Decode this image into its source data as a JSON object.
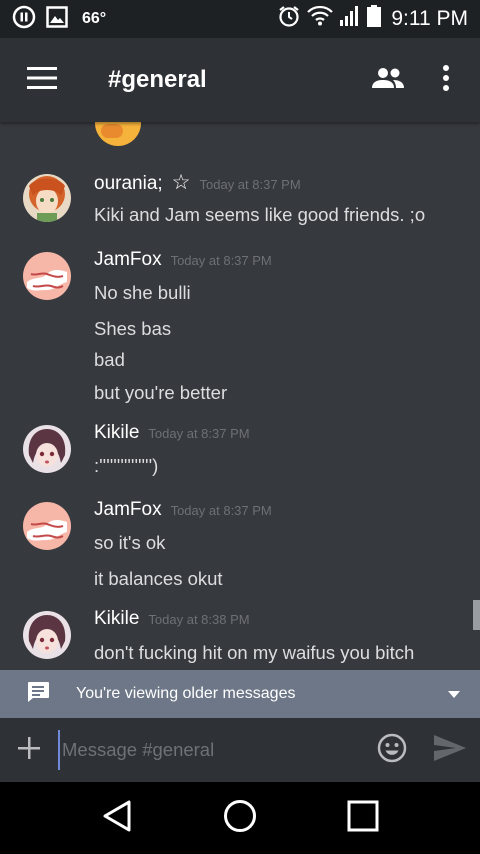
{
  "status_bar": {
    "temperature": "66°",
    "time": "9:11 PM"
  },
  "app_bar": {
    "channel": "#general"
  },
  "messages": [
    {
      "author": "ourania;",
      "star": "☆",
      "timestamp": "Today at 8:37 PM",
      "lines": [
        "Kiki and Jam seems like good friends. ;o"
      ]
    },
    {
      "author": "JamFox",
      "timestamp": "Today at 8:37 PM",
      "lines": [
        "No she bulli",
        "Shes bas",
        "bad",
        "but you're better"
      ]
    },
    {
      "author": "Kikile",
      "timestamp": "Today at 8:37 PM",
      "lines": [
        ":''''''''''''''')"
      ]
    },
    {
      "author": "JamFox",
      "timestamp": "Today at 8:37 PM",
      "lines": [
        "so it's ok",
        "it balances okut"
      ]
    },
    {
      "author": "Kikile",
      "timestamp": "Today at 8:38 PM",
      "lines": [
        "don't fucking hit on my waifus  you bitch"
      ]
    }
  ],
  "older_banner": {
    "text": "You're viewing older messages"
  },
  "composer": {
    "placeholder": "Message #general"
  },
  "colors": {
    "background": "#36393e",
    "appbar": "#2e3136",
    "banner": "#6d7787",
    "accent": "#7289da"
  },
  "icons": [
    "hamburger-icon",
    "members-icon",
    "more-vertical-icon",
    "chat-icon",
    "caret-down-icon",
    "plus-icon",
    "emoji-icon",
    "send-icon",
    "back-icon",
    "home-icon",
    "recents-icon"
  ]
}
